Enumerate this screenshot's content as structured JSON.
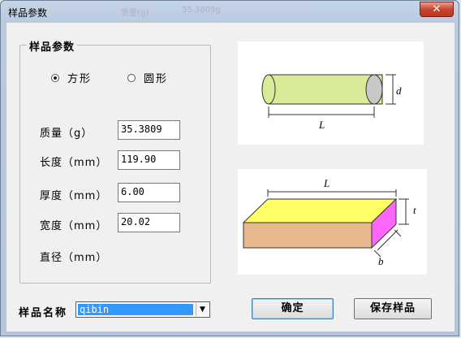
{
  "window": {
    "title": "样品参数",
    "close_glyph": "✕"
  },
  "ghost_text": [
    "质量(g)",
    "35.3809g"
  ],
  "group": {
    "title": "样品参数"
  },
  "shape": {
    "options": [
      {
        "label": "方形",
        "selected": true
      },
      {
        "label": "圆形",
        "selected": false
      }
    ]
  },
  "fields": [
    {
      "label": "质量（g）",
      "value": "35.3809"
    },
    {
      "label": "长度（mm）",
      "value": "119.90"
    },
    {
      "label": "厚度（mm）",
      "value": "6.00"
    },
    {
      "label": "宽度（mm）",
      "value": "20.02"
    },
    {
      "label": "直径（mm）",
      "value": ""
    }
  ],
  "diagrams": {
    "cylinder": {
      "length_label": "L",
      "diameter_label": "d",
      "body_color": "#d8ec98"
    },
    "box": {
      "length_label": "L",
      "thickness_label": "t",
      "width_label": "b",
      "top_color": "#ffff66",
      "front_color": "#e8b88e",
      "side_color": "#ff66ff"
    }
  },
  "sample_name": {
    "label": "样品名称",
    "value": "qibin",
    "dropdown_glyph": "▼"
  },
  "buttons": {
    "confirm": "确定",
    "save": "保存样品"
  }
}
